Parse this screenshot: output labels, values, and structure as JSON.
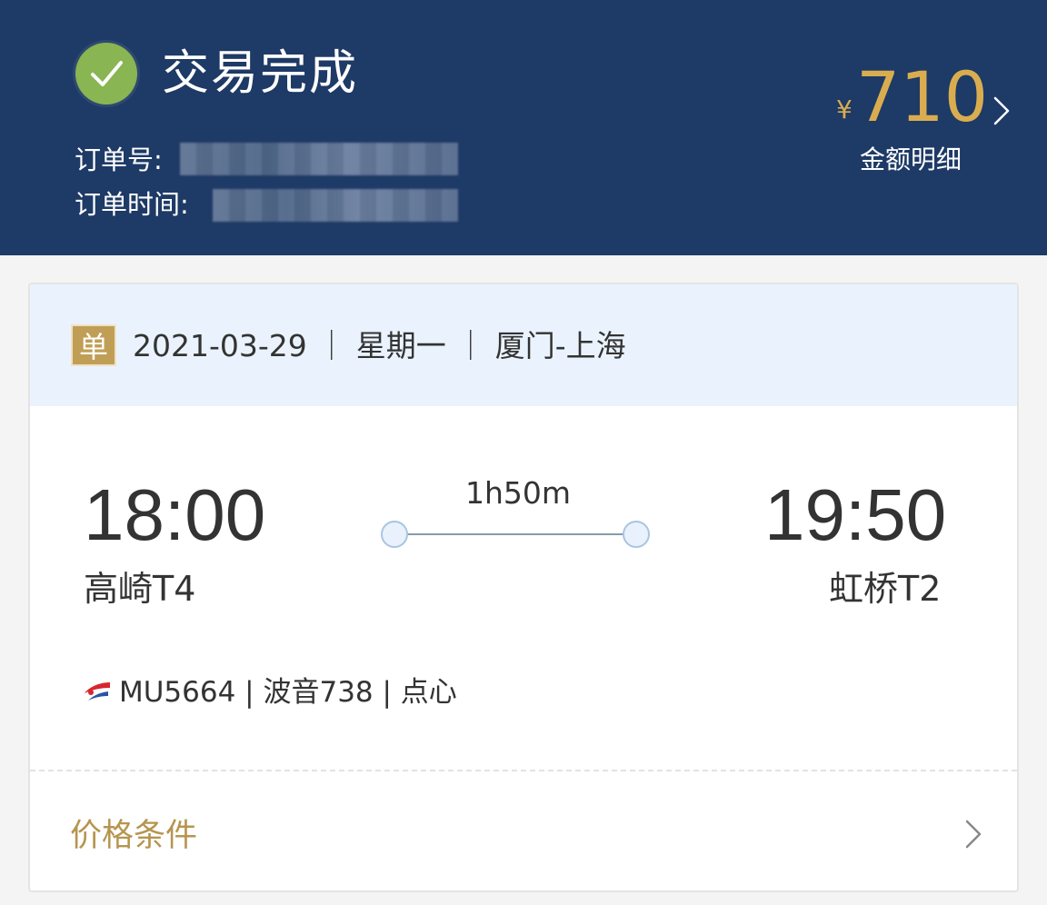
{
  "header": {
    "status_icon": "check-circle-icon",
    "status_title": "交易完成",
    "order_no_label": "订单号:",
    "order_time_label": "订单时间:",
    "currency_symbol": "¥",
    "amount": "710",
    "amount_detail_label": "金额明细",
    "colors": {
      "background": "#1e3a66",
      "accent": "#d9ad4f",
      "success": "#89b552"
    }
  },
  "trip": {
    "badge": "单",
    "summary": "2021-03-29 ｜ 星期一 ｜ 厦门-上海",
    "departure": {
      "time": "18:00",
      "airport": "高崎T4"
    },
    "arrival": {
      "time": "19:50",
      "airport": "虹桥T2"
    },
    "duration": "1h50m",
    "flight_info": "MU5664 | 波音738 | 点心",
    "airline_icon": "china-eastern-logo-icon"
  },
  "price_conditions": {
    "label": "价格条件",
    "color": "#b6954e"
  }
}
